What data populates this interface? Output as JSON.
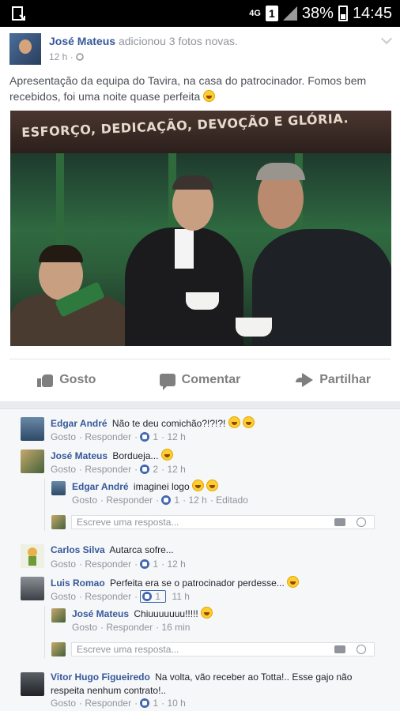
{
  "status_bar": {
    "network": "4G",
    "sim": "1",
    "battery": "38%",
    "time": "14:45"
  },
  "post": {
    "author": "José Mateus",
    "action": "adicionou 3 fotos novas.",
    "time": "12 h ·",
    "text": "Apresentação da equipa do Tavira, na casa do patrocinador. Fomos bem recebidos, foi uma noite quase perfeita",
    "photo_banner": "ESFORÇO, DEDICAÇÃO, DEVOÇÃO E GLÓRIA.",
    "actions": {
      "like": "Gosto",
      "comment": "Comentar",
      "share": "Partilhar"
    }
  },
  "comments": [
    {
      "name": "Edgar André",
      "text": "Não te deu comichão?!?!?!",
      "like": "Gosto",
      "reply": "Responder",
      "count": "1",
      "time": "12 h"
    },
    {
      "name": "José Mateus",
      "text": "Bordueja...",
      "like": "Gosto",
      "reply": "Responder",
      "count": "2",
      "time": "12 h",
      "replies": [
        {
          "name": "Edgar André",
          "text": "imaginei logo",
          "like": "Gosto",
          "reply": "Responder",
          "count": "1",
          "time": "12 h",
          "edited": "Editado"
        }
      ],
      "reply_placeholder": "Escreve uma resposta..."
    },
    {
      "name": "Carlos Silva",
      "text": "Autarca sofre...",
      "like": "Gosto",
      "reply": "Responder",
      "count": "1",
      "time": "12 h"
    },
    {
      "name": "Luis Romao",
      "text": "Perfeita era se o patrocinador perdesse...",
      "like": "Gosto",
      "reply": "Responder",
      "count": "1",
      "time": "11 h",
      "replies": [
        {
          "name": "José Mateus",
          "text": "Chiuuuuuuu!!!!!",
          "like": "Gosto",
          "reply": "Responder",
          "time": "16 min"
        }
      ],
      "reply_placeholder": "Escreve uma resposta..."
    },
    {
      "name": "Vitor Hugo Figueiredo",
      "text": "Na volta, vão receber ao Totta!.. Esse gajo não respeita nenhum contrato!..",
      "like": "Gosto",
      "reply": "Responder",
      "count": "1",
      "time": "10 h"
    }
  ],
  "colors": {
    "link": "#365899",
    "meta": "#90949c",
    "like_blue": "#4267b2"
  },
  "icons": [
    "download-icon",
    "signal-icon",
    "battery-icon",
    "globe-icon",
    "chevron-down-icon",
    "like-icon",
    "comment-icon",
    "share-icon",
    "camera-icon",
    "smiley-icon"
  ]
}
